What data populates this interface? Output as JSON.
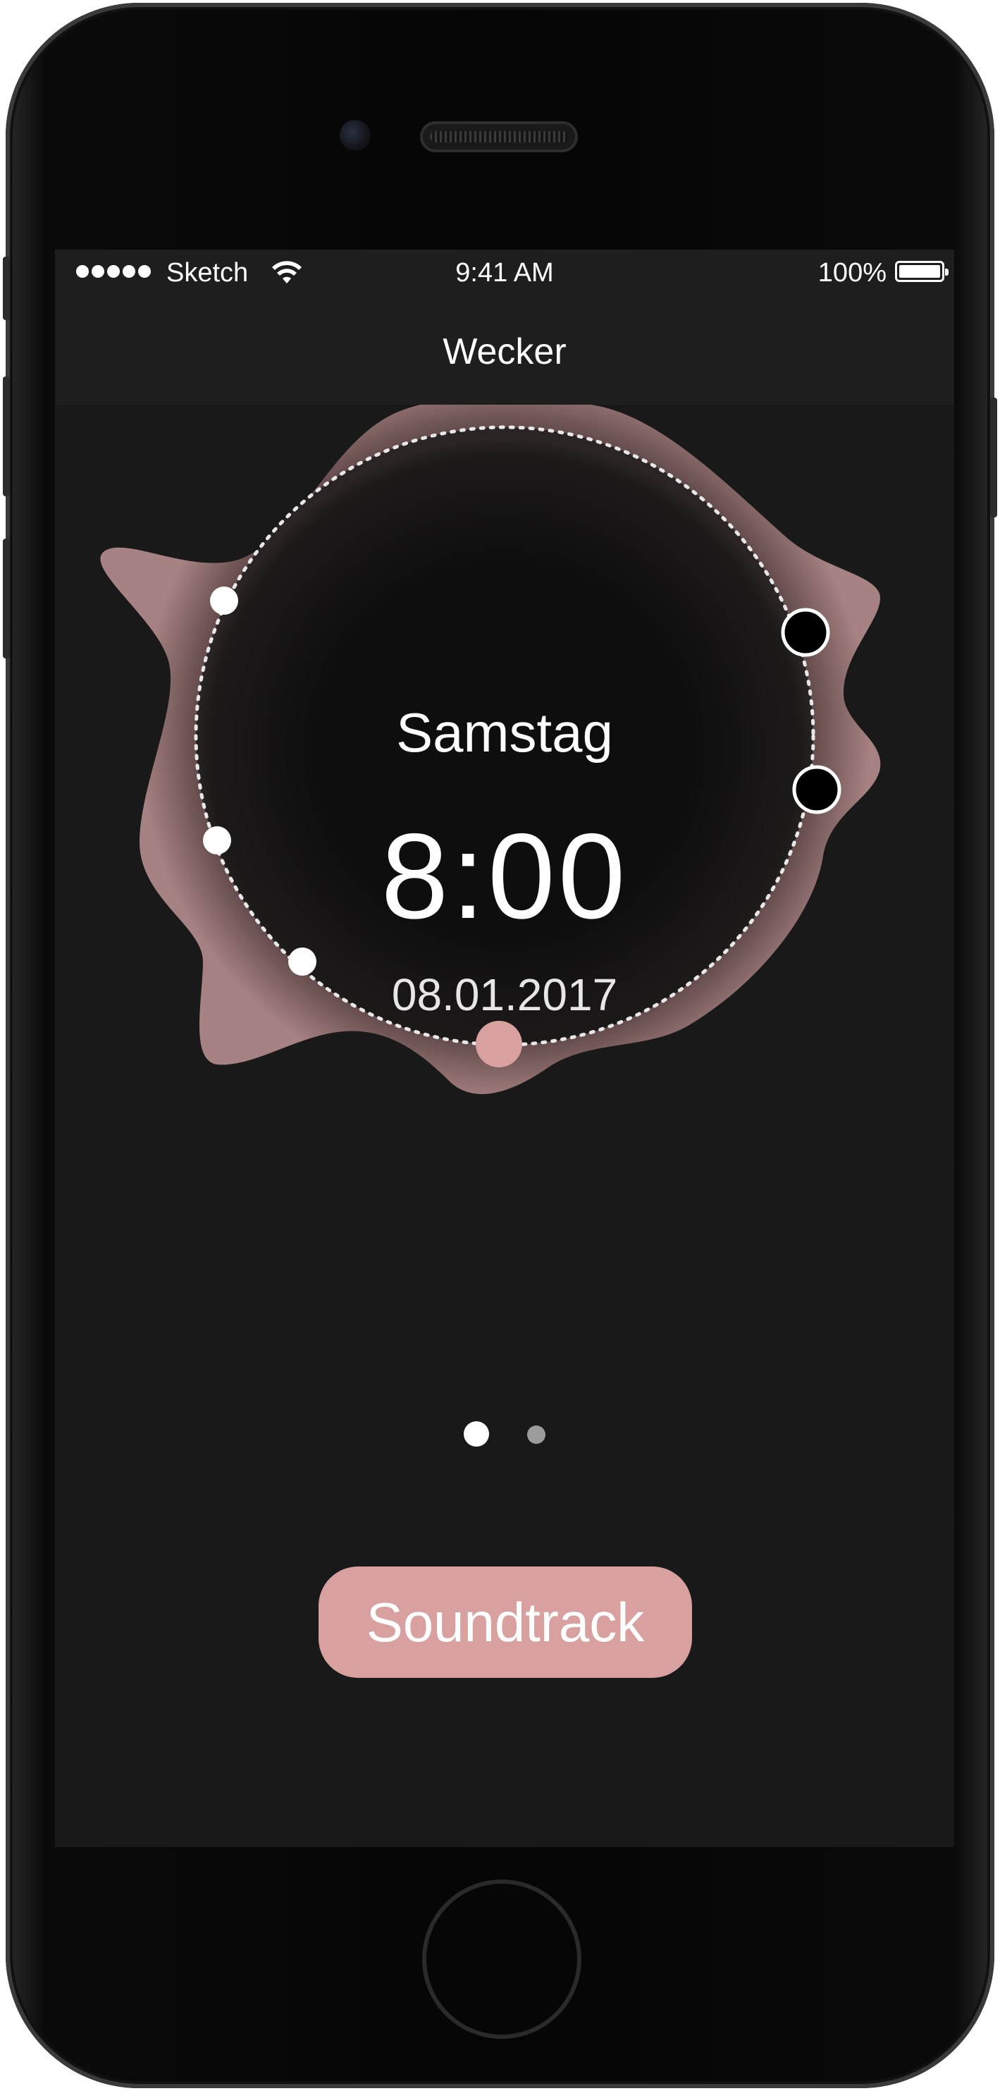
{
  "status_bar": {
    "carrier": "Sketch",
    "time": "9:41 AM",
    "battery_percent": "100%",
    "signal_bars": 5,
    "battery_level": 1.0
  },
  "nav": {
    "title": "Wecker"
  },
  "alarm": {
    "day": "Samstag",
    "time": "8:00",
    "date": "08.01.2017"
  },
  "pager": {
    "pages": 2,
    "active_index": 0
  },
  "soundtrack_button": {
    "label": "Soundtrack"
  },
  "colors": {
    "accent": "#d9a0a0",
    "screen_background": "#191919",
    "bar_background": "#1e1e1e",
    "text": "#ffffff",
    "dot_inactive": "#9c9c9c"
  },
  "icons": {
    "wifi": "wifi-icon",
    "battery": "battery-icon",
    "signal": "signal-dots-icon"
  }
}
